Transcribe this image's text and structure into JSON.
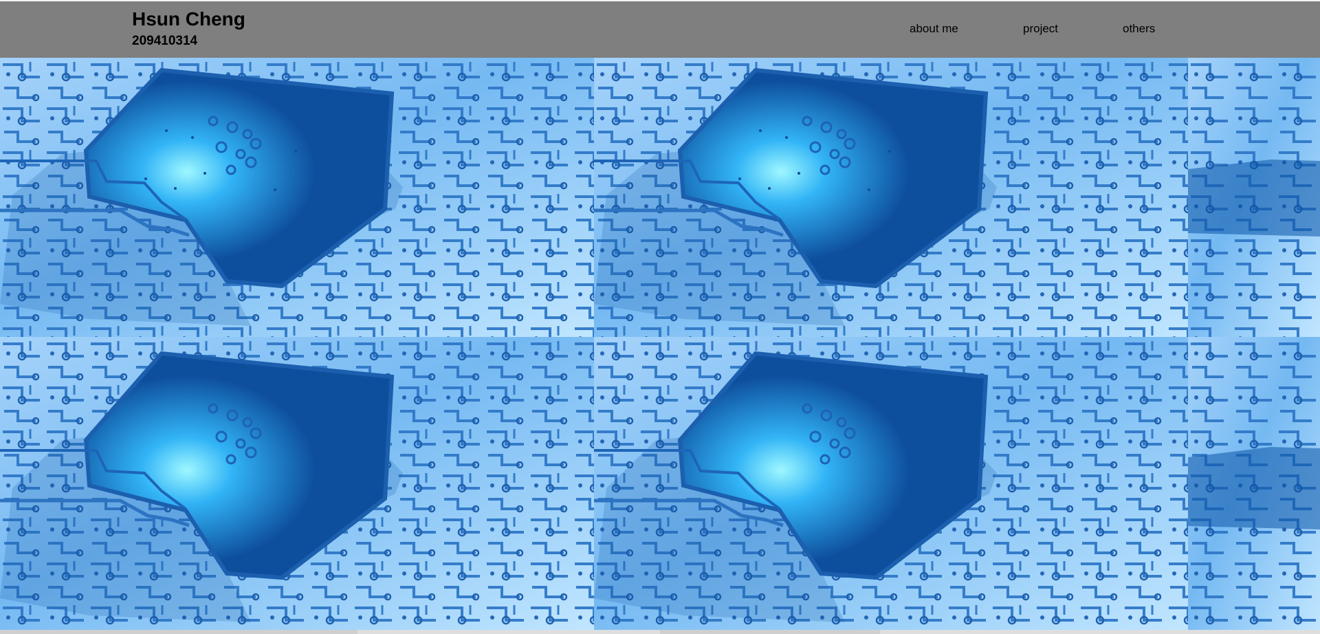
{
  "header": {
    "name": "Hsun Cheng",
    "student_id": "209410314"
  },
  "nav": {
    "about_label": "about me",
    "project_label": "project",
    "others_label": "others"
  },
  "colors": {
    "header_bg": "#7f7f7f",
    "board_light": "#b7ddfb",
    "board_dark": "#0c4f9e",
    "glow": "#8ef1ff"
  },
  "hero": {
    "background": "blue circuit board pattern"
  }
}
